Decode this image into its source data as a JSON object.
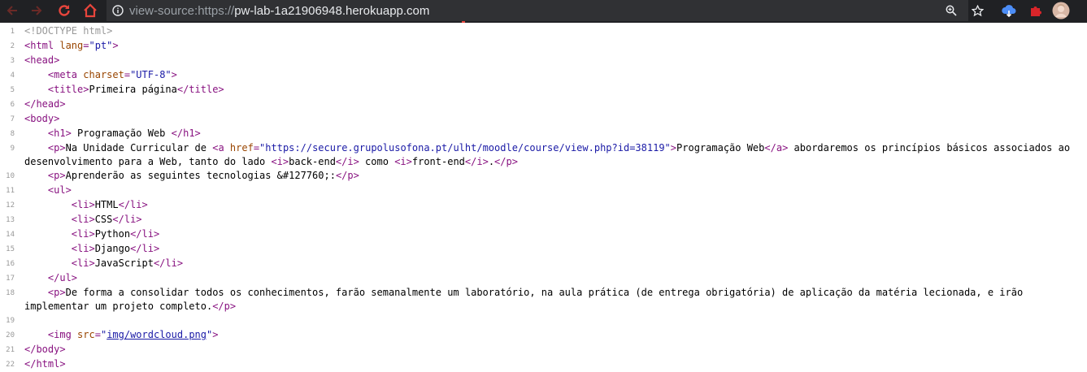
{
  "browser": {
    "back_icon": "arrow-left-icon",
    "forward_icon": "arrow-right-icon",
    "reload_icon": "reload-icon",
    "home_icon": "home-icon",
    "url_prefix": "view-source:https://",
    "url_host": "pw-lab-1a21906948.herokuapp.com",
    "accent_red": "#e8453c",
    "toolbar_bg": "#202124"
  },
  "source": {
    "lines": [
      {
        "n": "1",
        "parts": [
          [
            "comment",
            "<!DOCTYPE html>"
          ]
        ]
      },
      {
        "n": "2",
        "parts": [
          [
            "tag",
            "<html "
          ],
          [
            "attr",
            "lang"
          ],
          [
            "tag",
            "="
          ],
          [
            "val",
            "\"pt\""
          ],
          [
            "tag",
            ">"
          ]
        ]
      },
      {
        "n": "3",
        "parts": [
          [
            "tag",
            "<head>"
          ]
        ]
      },
      {
        "n": "4",
        "parts": [
          [
            "txt",
            "    "
          ],
          [
            "tag",
            "<meta "
          ],
          [
            "attr",
            "charset"
          ],
          [
            "tag",
            "="
          ],
          [
            "val",
            "\"UTF-8\""
          ],
          [
            "tag",
            ">"
          ]
        ]
      },
      {
        "n": "5",
        "parts": [
          [
            "txt",
            "    "
          ],
          [
            "tag",
            "<title>"
          ],
          [
            "txt",
            "Primeira página"
          ],
          [
            "tag",
            "</title>"
          ]
        ]
      },
      {
        "n": "6",
        "parts": [
          [
            "tag",
            "</head>"
          ]
        ]
      },
      {
        "n": "7",
        "parts": [
          [
            "tag",
            "<body>"
          ]
        ]
      },
      {
        "n": "8",
        "parts": [
          [
            "txt",
            "    "
          ],
          [
            "tag",
            "<h1>"
          ],
          [
            "txt",
            " Programação Web "
          ],
          [
            "tag",
            "</h1>"
          ]
        ]
      },
      {
        "n": "9",
        "parts": [
          [
            "txt",
            "    "
          ],
          [
            "tag",
            "<p>"
          ],
          [
            "txt",
            "Na Unidade Curricular de "
          ],
          [
            "tag",
            "<a "
          ],
          [
            "attr",
            "href"
          ],
          [
            "tag",
            "="
          ],
          [
            "val",
            "\"https://secure.grupolusofona.pt/ulht/moodle/course/view.php?id=38119\""
          ],
          [
            "tag",
            ">"
          ],
          [
            "txt",
            "Programação Web"
          ],
          [
            "tag",
            "</a>"
          ],
          [
            "txt",
            " abordaremos os princípios básicos associados ao desenvolvimento para a Web, tanto do lado "
          ],
          [
            "tag",
            "<i>"
          ],
          [
            "txt",
            "back-end"
          ],
          [
            "tag",
            "</i>"
          ],
          [
            "txt",
            " como "
          ],
          [
            "tag",
            "<i>"
          ],
          [
            "txt",
            "front-end"
          ],
          [
            "tag",
            "</i>"
          ],
          [
            "txt",
            "."
          ],
          [
            "tag",
            "</p>"
          ]
        ]
      },
      {
        "n": "10",
        "parts": [
          [
            "txt",
            "    "
          ],
          [
            "tag",
            "<p>"
          ],
          [
            "txt",
            "Aprenderão as seguintes tecnologias &#127760;:"
          ],
          [
            "tag",
            "</p>"
          ]
        ]
      },
      {
        "n": "11",
        "parts": [
          [
            "txt",
            "    "
          ],
          [
            "tag",
            "<ul>"
          ]
        ]
      },
      {
        "n": "12",
        "parts": [
          [
            "txt",
            "        "
          ],
          [
            "tag",
            "<li>"
          ],
          [
            "txt",
            "HTML"
          ],
          [
            "tag",
            "</li>"
          ]
        ]
      },
      {
        "n": "13",
        "parts": [
          [
            "txt",
            "        "
          ],
          [
            "tag",
            "<li>"
          ],
          [
            "txt",
            "CSS"
          ],
          [
            "tag",
            "</li>"
          ]
        ]
      },
      {
        "n": "14",
        "parts": [
          [
            "txt",
            "        "
          ],
          [
            "tag",
            "<li>"
          ],
          [
            "txt",
            "Python"
          ],
          [
            "tag",
            "</li>"
          ]
        ]
      },
      {
        "n": "15",
        "parts": [
          [
            "txt",
            "        "
          ],
          [
            "tag",
            "<li>"
          ],
          [
            "txt",
            "Django"
          ],
          [
            "tag",
            "</li>"
          ]
        ]
      },
      {
        "n": "16",
        "parts": [
          [
            "txt",
            "        "
          ],
          [
            "tag",
            "<li>"
          ],
          [
            "txt",
            "JavaScript"
          ],
          [
            "tag",
            "</li>"
          ]
        ]
      },
      {
        "n": "17",
        "parts": [
          [
            "txt",
            "    "
          ],
          [
            "tag",
            "</ul>"
          ]
        ]
      },
      {
        "n": "18",
        "parts": [
          [
            "txt",
            "    "
          ],
          [
            "tag",
            "<p>"
          ],
          [
            "txt",
            "De forma a consolidar todos os conhecimentos, farão semanalmente um laboratório, na aula prática (de entrega obrigatória) de aplicação da matéria lecionada, e irão implementar um projeto completo."
          ],
          [
            "tag",
            "</p>"
          ]
        ]
      },
      {
        "n": "19",
        "parts": []
      },
      {
        "n": "20",
        "parts": [
          [
            "txt",
            "    "
          ],
          [
            "tag",
            "<img "
          ],
          [
            "attr",
            "src"
          ],
          [
            "tag",
            "="
          ],
          [
            "val",
            "\""
          ],
          [
            "link",
            "img/wordcloud.png"
          ],
          [
            "val",
            "\""
          ],
          [
            "tag",
            ">"
          ]
        ]
      },
      {
        "n": "21",
        "parts": [
          [
            "tag",
            "</body>"
          ]
        ]
      },
      {
        "n": "22",
        "parts": [
          [
            "tag",
            "</html>"
          ]
        ]
      }
    ]
  }
}
